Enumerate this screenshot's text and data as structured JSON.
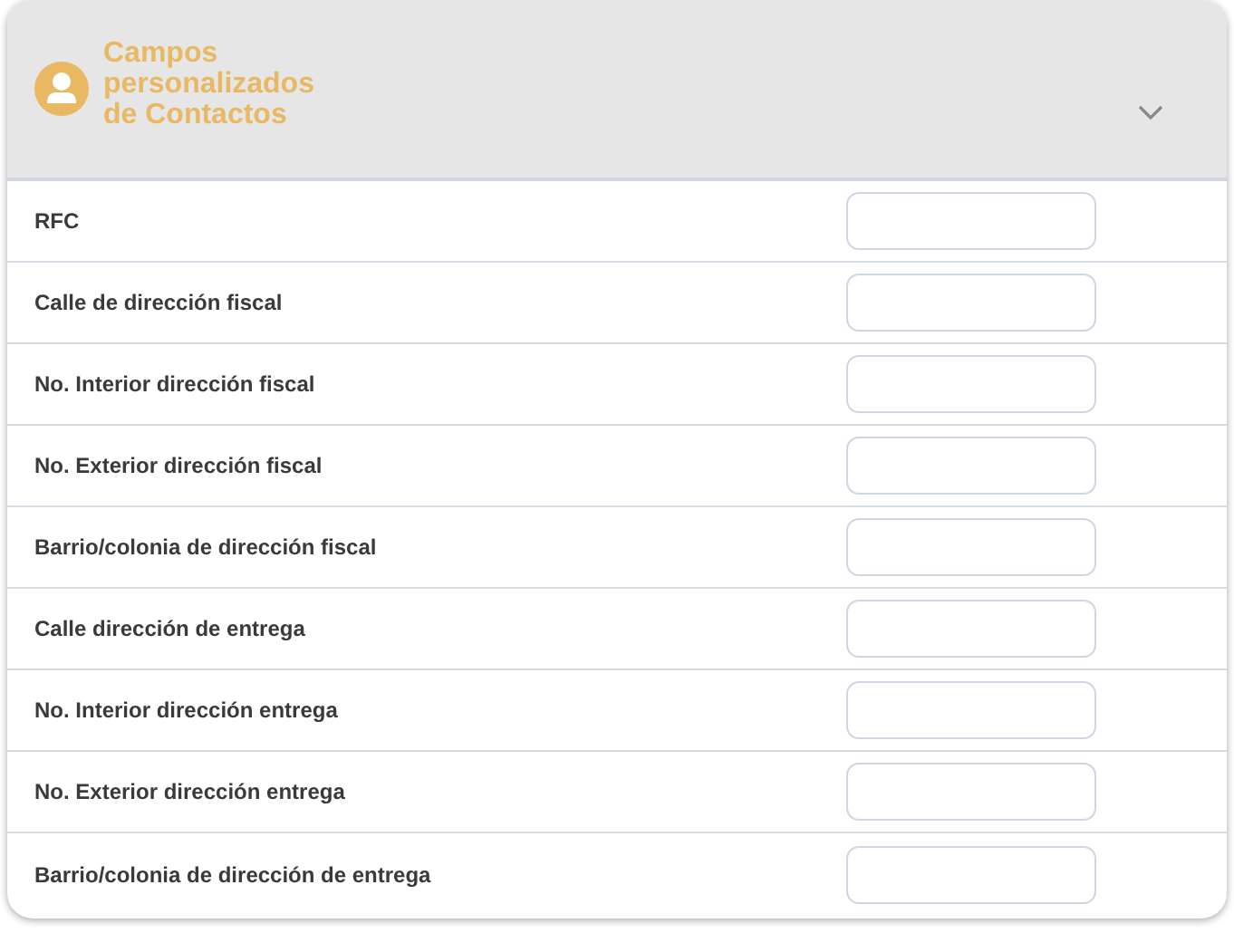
{
  "panel": {
    "title": "Campos personalizados de Contactos",
    "expanded": true
  },
  "fields": [
    {
      "label": "RFC"
    },
    {
      "label": "Calle de dirección fiscal"
    },
    {
      "label": "No. Interior dirección fiscal"
    },
    {
      "label": "No. Exterior dirección fiscal"
    },
    {
      "label": "Barrio/colonia de dirección fiscal"
    },
    {
      "label": "Calle dirección de entrega"
    },
    {
      "label": "No. Interior dirección entrega"
    },
    {
      "label": "No. Exterior dirección entrega"
    },
    {
      "label": "Barrio/colonia de dirección de entrega"
    }
  ]
}
